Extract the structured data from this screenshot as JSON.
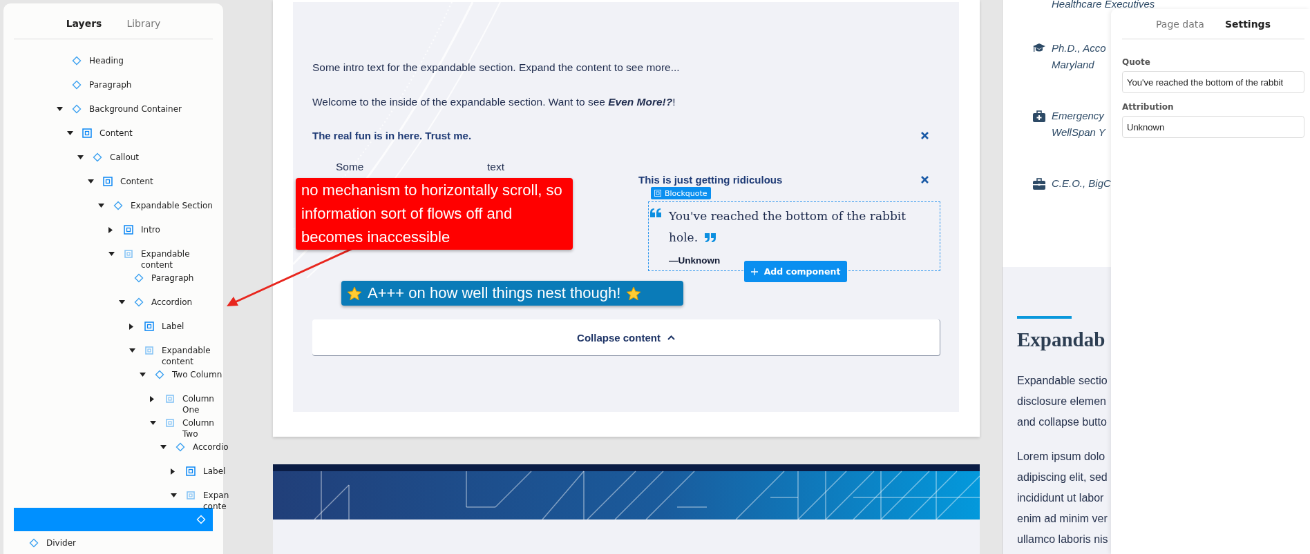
{
  "layers_panel": {
    "tabs": [
      {
        "label": "Layers",
        "selected": true
      },
      {
        "label": "Library",
        "selected": false
      }
    ],
    "tree": [
      {
        "label": "Heading",
        "kind": "component",
        "selected": false
      },
      {
        "label": "Paragraph",
        "kind": "component",
        "selected": false
      },
      {
        "label": "Background Container",
        "kind": "component",
        "expanded": true,
        "selected": false,
        "children": [
          {
            "label": "Content",
            "kind": "container",
            "expanded": true,
            "selected": false,
            "children": [
              {
                "label": "Callout",
                "kind": "component",
                "expanded": true,
                "selected": false,
                "children": [
                  {
                    "label": "Content",
                    "kind": "container",
                    "expanded": true,
                    "selected": false,
                    "children": [
                      {
                        "label": "Expandable Section",
                        "kind": "component",
                        "expanded": true,
                        "selected": false,
                        "children": [
                          {
                            "label": "Intro",
                            "kind": "container",
                            "expanded": false,
                            "selected": false
                          },
                          {
                            "label": "Expandable content",
                            "kind": "slot",
                            "expanded": true,
                            "selected": false,
                            "children": [
                              {
                                "label": "Paragraph",
                                "kind": "component",
                                "selected": false
                              },
                              {
                                "label": "Accordion",
                                "kind": "component",
                                "expanded": true,
                                "selected": false,
                                "children": [
                                  {
                                    "label": "Label",
                                    "kind": "container",
                                    "expanded": false,
                                    "selected": false
                                  },
                                  {
                                    "label": "Expandable content",
                                    "kind": "slot",
                                    "expanded": true,
                                    "selected": false,
                                    "children": [
                                      {
                                        "label": "Two Column",
                                        "kind": "component",
                                        "expanded": true,
                                        "selected": false,
                                        "children": [
                                          {
                                            "label": "Column One",
                                            "kind": "slot",
                                            "expanded": false,
                                            "selected": false
                                          },
                                          {
                                            "label": "Column Two",
                                            "kind": "slot",
                                            "expanded": true,
                                            "selected": false,
                                            "children": [
                                              {
                                                "label": "Accordio",
                                                "kind": "component",
                                                "expanded": true,
                                                "selected": false,
                                                "children": [
                                                  {
                                                    "label": "Label",
                                                    "kind": "container",
                                                    "expanded": false,
                                                    "selected": false
                                                  },
                                                  {
                                                    "label": "Expan conte",
                                                    "kind": "slot",
                                                    "expanded": true,
                                                    "selected": false,
                                                    "children": [
                                                      {
                                                        "kind": "component",
                                                        "selected": true
                                                      }
                                                    ]
                                                  }
                                                ]
                                              }
                                            ]
                                          }
                                        ]
                                      }
                                    ]
                                  }
                                ]
                              }
                            ]
                          }
                        ]
                      }
                    ]
                  }
                ]
              }
            ]
          }
        ]
      }
    ],
    "root_items": [
      {
        "label": "Divider",
        "kind": "component",
        "selected": false
      }
    ]
  },
  "canvas": {
    "intro": "Some intro text for the expandable section. Expand the content to see more...",
    "body": "Welcome to the inside of the expandable section. Want to see **Even More!?**!",
    "accordion": {
      "label": "The real fun is in here. Trust me.",
      "expanded": true,
      "column_one": [
        "Some",
        "text"
      ],
      "column_two": {
        "label": "This is just getting ridiculous",
        "expanded": true,
        "blockquote": {
          "tag": "Blockquote",
          "quote": "You've reached the bottom of the rabbit hole.",
          "attribution": "—Unknown"
        }
      }
    },
    "add_component": "Add component",
    "collapse": "Collapse content"
  },
  "annotations": [
    {
      "kind": "callout",
      "color": "#ff0000",
      "text": "no mechanism to horizontally scroll, so information sort of flows off and becomes inaccessible"
    },
    {
      "kind": "praise",
      "color": "#0a7bb8",
      "text": "A+++ on how well things nest though!"
    }
  ],
  "preview": {
    "top_line": "Healthcare Executives",
    "credentials": [
      {
        "kind": "education",
        "lines": [
          "Ph.D., Acco",
          "Maryland"
        ]
      },
      {
        "kind": "medical",
        "lines": [
          "Emergency",
          "WellSpan Y"
        ]
      },
      {
        "kind": "work",
        "lines": [
          "C.E.O., BigC"
        ]
      }
    ],
    "heading": "Expandab",
    "paragraphs": [
      [
        "Expandable sectio",
        "disclosure elemen",
        "and collapse butto"
      ],
      [
        "Lorem ipsum dolo",
        "adipiscing elit, sed",
        "incididunt ut labor",
        "enim ad minim ver",
        "ullamco laboris nis"
      ]
    ]
  },
  "settings_panel": {
    "tabs": [
      {
        "label": "Page data",
        "selected": false
      },
      {
        "label": "Settings",
        "selected": true
      }
    ],
    "fields": [
      {
        "label": "Quote",
        "value": "You've reached the bottom of the rabbit"
      },
      {
        "label": "Attribution",
        "value": "Unknown"
      }
    ]
  }
}
